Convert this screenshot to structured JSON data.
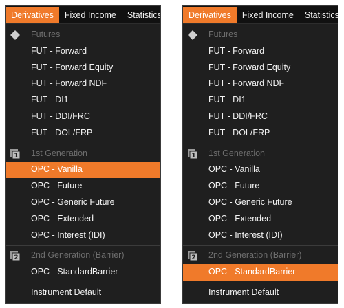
{
  "accent_color": "#f07a2a",
  "panels": [
    {
      "tabs": [
        "Derivatives",
        "Fixed Income",
        "Statistics"
      ],
      "active_tab": 0,
      "highlighted": "OPC - Vanilla",
      "groups": [
        {
          "header": "Futures",
          "icon": "diamond-icon",
          "items": [
            "FUT - Forward",
            "FUT - Forward Equity",
            "FUT - Forward NDF",
            "FUT - DI1",
            "FUT - DDI/FRC",
            "FUT - DOL/FRP"
          ]
        },
        {
          "header": "1st Generation",
          "icon": "first-generation-icon",
          "items": [
            "OPC - Vanilla",
            "OPC - Future",
            "OPC - Generic Future",
            "OPC - Extended",
            "OPC - Interest (IDI)"
          ]
        },
        {
          "header": "2nd Generation (Barrier)",
          "icon": "second-generation-icon",
          "items": [
            "OPC - StandardBarrier"
          ]
        }
      ],
      "footer": "Instrument Default"
    },
    {
      "tabs": [
        "Derivatives",
        "Fixed Income",
        "Statistics"
      ],
      "active_tab": 0,
      "highlighted": "OPC - StandardBarrier",
      "groups": [
        {
          "header": "Futures",
          "icon": "diamond-icon",
          "items": [
            "FUT - Forward",
            "FUT - Forward Equity",
            "FUT - Forward NDF",
            "FUT - DI1",
            "FUT - DDI/FRC",
            "FUT - DOL/FRP"
          ]
        },
        {
          "header": "1st Generation",
          "icon": "first-generation-icon",
          "items": [
            "OPC - Vanilla",
            "OPC - Future",
            "OPC - Generic Future",
            "OPC - Extended",
            "OPC - Interest (IDI)"
          ]
        },
        {
          "header": "2nd Generation (Barrier)",
          "icon": "second-generation-icon",
          "items": [
            "OPC - StandardBarrier"
          ]
        }
      ],
      "footer": "Instrument Default"
    }
  ]
}
